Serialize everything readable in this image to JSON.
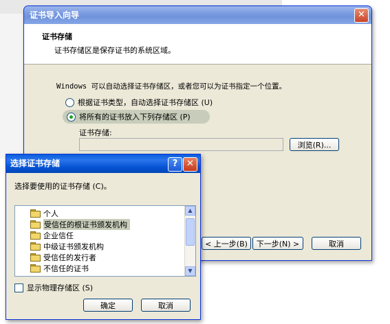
{
  "wizard": {
    "title": "证书导入向导",
    "close_glyph": "✕",
    "header_title": "证书存储",
    "header_subtitle": "证书存储区是保存证书的系统区域。",
    "auto_text": "Windows 可以自动选择证书存储区，或者您可以为证书指定一个位置。",
    "radio_auto": "根据证书类型，自动选择证书存储区 (U)",
    "radio_manual": "将所有的证书放入下列存储区 (P)",
    "store_label": "证书存储:",
    "store_value": "",
    "browse_label": "浏览(R)...",
    "back_label": "< 上一步(B)",
    "next_label": "下一步(N) >",
    "cancel_label": "取消"
  },
  "dialog": {
    "title": "选择证书存储",
    "help_glyph": "?",
    "close_glyph": "✕",
    "prompt": "选择要使用的证书存储 (C)。",
    "stores": [
      {
        "label": "个人",
        "selected": false
      },
      {
        "label": "受信任的根证书颁发机构",
        "selected": true
      },
      {
        "label": "企业信任",
        "selected": false
      },
      {
        "label": "中级证书颁发机构",
        "selected": false
      },
      {
        "label": "受信任的发行者",
        "selected": false
      },
      {
        "label": "不信任的证书",
        "selected": false
      }
    ],
    "show_physical": "显示物理存储区 (S)",
    "ok_label": "确定",
    "cancel_label": "取消"
  }
}
